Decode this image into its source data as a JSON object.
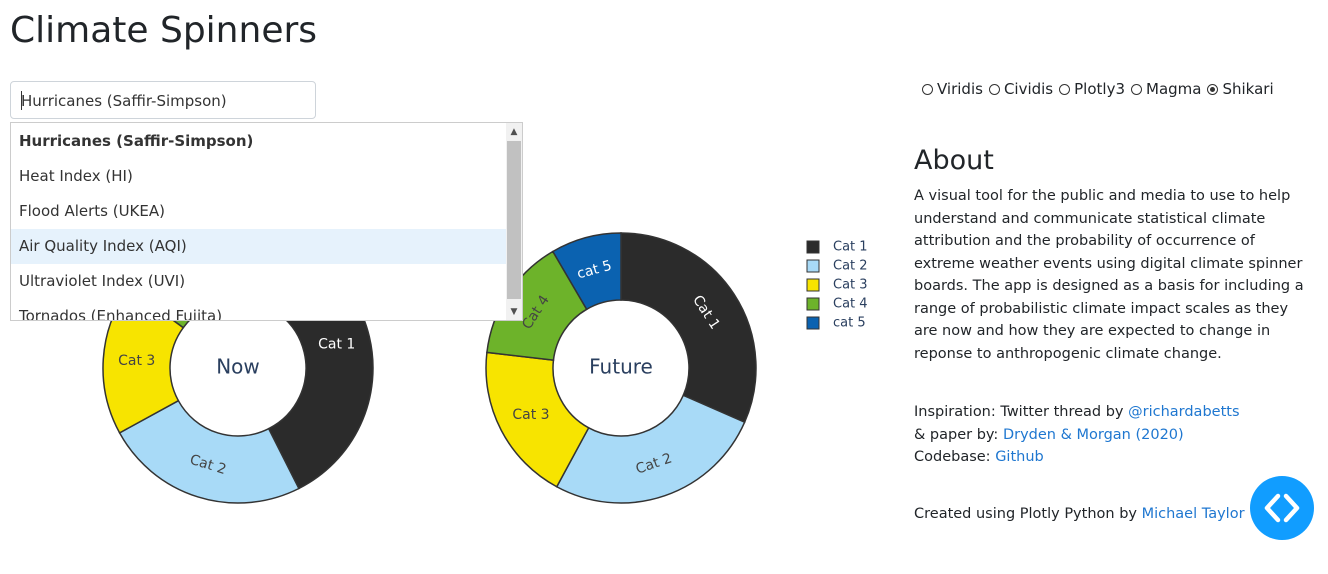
{
  "page": {
    "title": "Climate Spinners"
  },
  "scale_select": {
    "value": "Hurricanes (Saffir-Simpson)",
    "options": [
      "Hurricanes (Saffir-Simpson)",
      "Heat Index (HI)",
      "Flood Alerts (UKEA)",
      "Air Quality Index (AQI)",
      "Ultraviolet Index (UVI)",
      "Tornados (Enhanced Fujita)"
    ]
  },
  "colorscales": {
    "options": [
      "Viridis",
      "Cividis",
      "Plotly3",
      "Magma",
      "Shikari"
    ],
    "selected": "Shikari"
  },
  "about": {
    "heading": "About",
    "text": "A visual tool for the public and media to use to help understand and communicate statistical climate attribution and the probability of occurrence of extreme weather events using digital climate spinner boards. The app is designed as a basis for including a range of probabilistic climate impact scales as they are now and how they are expected to change in reponse to anthropogenic climate change.",
    "inspiration_label": "Inspiration: Twitter thread by ",
    "inspiration_link": "@richardabetts",
    "paper_label": "& paper by: ",
    "paper_link": "Dryden & Morgan (2020)",
    "codebase_label": "Codebase: ",
    "codebase_link": "Github",
    "created_label": "Created using Plotly Python by ",
    "created_link": "Michael Taylor"
  },
  "chart_data": [
    {
      "type": "pie",
      "hole": true,
      "center_label": "Now",
      "categories": [
        "Cat 1",
        "Cat 2",
        "Cat 3",
        "Cat 4",
        "cat 5"
      ],
      "values": [
        40,
        23,
        17,
        12,
        2
      ]
    },
    {
      "type": "pie",
      "hole": true,
      "center_label": "Future",
      "categories": [
        "Cat 1",
        "Cat 2",
        "Cat 3",
        "Cat 4",
        "cat 5"
      ],
      "values": [
        30,
        25,
        18,
        14,
        8
      ]
    }
  ],
  "legend": {
    "entries": [
      "Cat 1",
      "Cat 2",
      "Cat 3",
      "Cat 4",
      "cat 5"
    ],
    "colors": [
      "#2b2b2b",
      "#a8daf7",
      "#f7e400",
      "#6db32a",
      "#0b62b0"
    ]
  }
}
